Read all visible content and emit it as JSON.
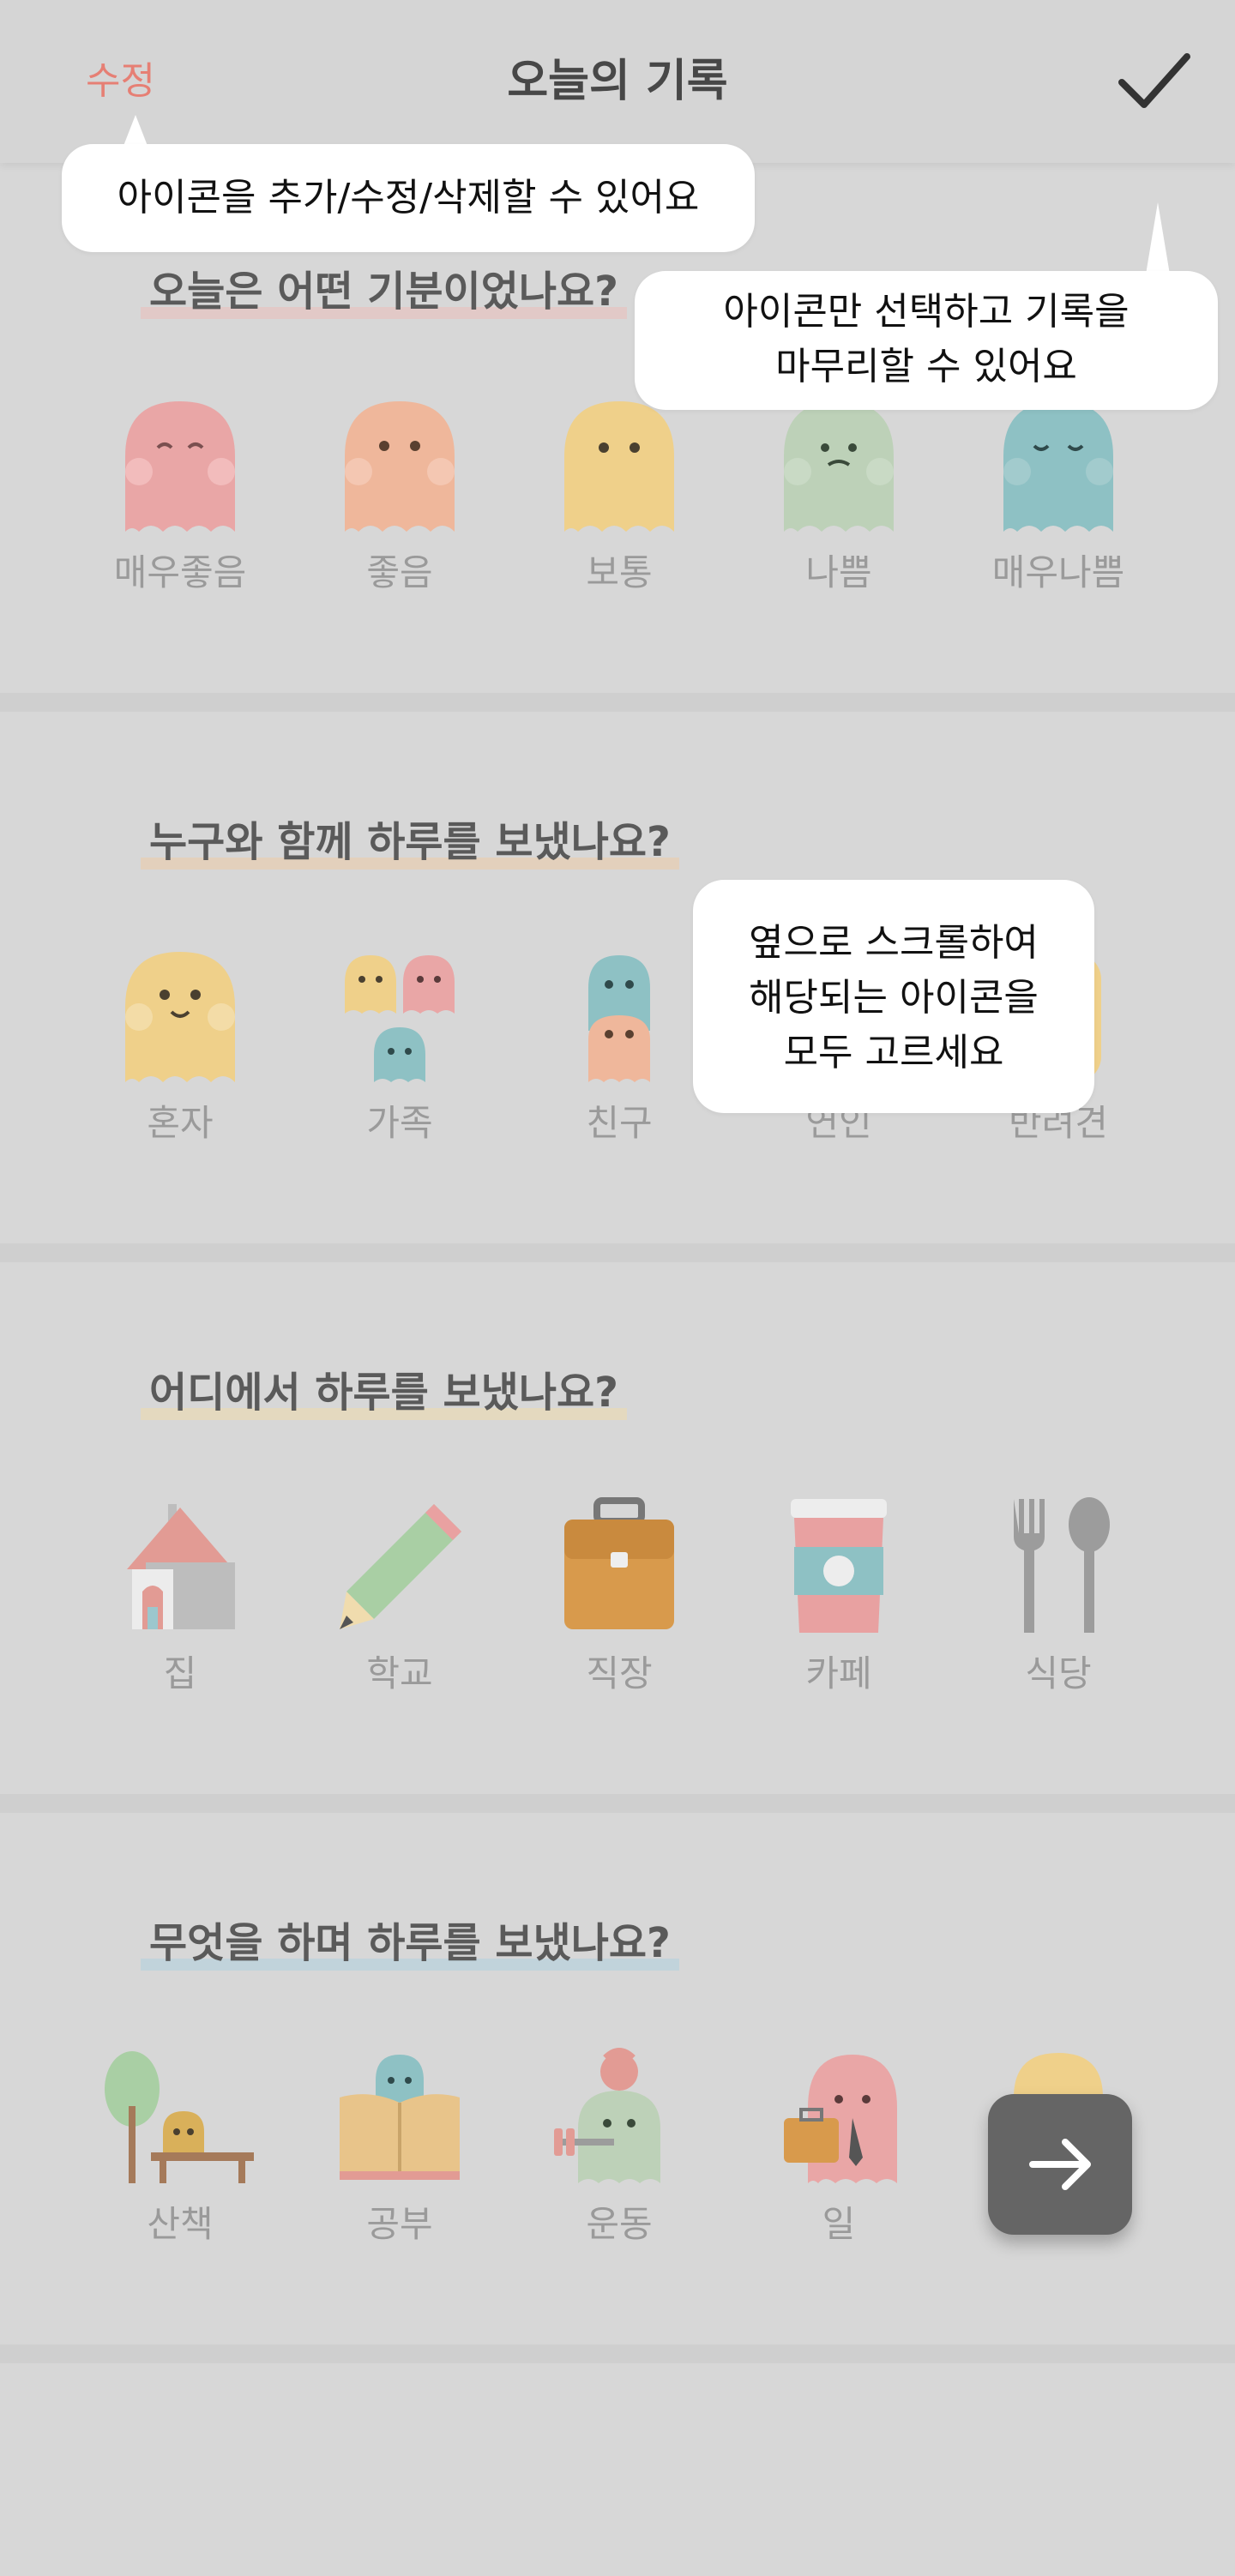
{
  "header": {
    "edit_label": "수정",
    "title": "오늘의 기록",
    "confirm_icon": "check-icon"
  },
  "tooltips": {
    "edit_tip": "아이콘을 추가/수정/삭제할 수 있어요",
    "confirm_tip_line1": "아이콘만 선택하고 기록을",
    "confirm_tip_line2": "마무리할 수 있어요",
    "scroll_tip_line1": "옆으로 스크롤하여",
    "scroll_tip_line2": "해당되는 아이콘을",
    "scroll_tip_line3": "모두 고르세요"
  },
  "sections": [
    {
      "title": "오늘은 어떤 기분이었나요?",
      "highlight_color": "#f0b9b3",
      "items": [
        {
          "label": "매우좋음",
          "icon": "ghost-very-good-icon",
          "color": "#e9a6a6"
        },
        {
          "label": "좋음",
          "icon": "ghost-good-icon",
          "color": "#efb79b"
        },
        {
          "label": "보통",
          "icon": "ghost-normal-icon",
          "color": "#efd08a"
        },
        {
          "label": "나쁨",
          "icon": "ghost-bad-icon",
          "color": "#bdd1b8"
        },
        {
          "label": "매우나쁨",
          "icon": "ghost-very-bad-icon",
          "color": "#8ec1c4"
        }
      ]
    },
    {
      "title": "누구와 함께 하루를 보냈나요?",
      "highlight_color": "#f2c79c",
      "items": [
        {
          "label": "혼자",
          "icon": "alone-ghost-icon",
          "color": "#efd08a"
        },
        {
          "label": "가족",
          "icon": "family-ghosts-icon",
          "color": "#e9a6a6"
        },
        {
          "label": "친구",
          "icon": "friend-ghosts-icon",
          "color": "#8ec1c4"
        },
        {
          "label": "연인",
          "icon": "lover-ghosts-icon",
          "color": "#efb79b"
        },
        {
          "label": "반려견",
          "icon": "pet-icon",
          "color": "#efd08a"
        }
      ]
    },
    {
      "title": "어디에서 하루를 보냈나요?",
      "highlight_color": "#f3dca2",
      "items": [
        {
          "label": "집",
          "icon": "house-icon",
          "color": "#e29b94"
        },
        {
          "label": "학교",
          "icon": "pencil-icon",
          "color": "#a9cfa4"
        },
        {
          "label": "직장",
          "icon": "briefcase-icon",
          "color": "#d89a4c"
        },
        {
          "label": "카페",
          "icon": "coffee-cup-icon",
          "color": "#e8a1a1"
        },
        {
          "label": "식당",
          "icon": "fork-spoon-icon",
          "color": "#9c9c9c"
        }
      ]
    },
    {
      "title": "무엇을 하며 하루를 보냈나요?",
      "highlight_color": "#a6cfe1",
      "items": [
        {
          "label": "산책",
          "icon": "walk-tree-bench-icon",
          "color": "#cfa34a"
        },
        {
          "label": "공부",
          "icon": "study-book-icon",
          "color": "#d4aa6a"
        },
        {
          "label": "운동",
          "icon": "exercise-kettlebell-icon",
          "color": "#bdd1b8"
        },
        {
          "label": "일",
          "icon": "work-ghost-icon",
          "color": "#e9a6a6"
        },
        {
          "label": "",
          "icon": "partial-ghost-icon",
          "color": "#efd08a"
        }
      ]
    }
  ],
  "fab": {
    "icon": "arrow-right-icon"
  }
}
